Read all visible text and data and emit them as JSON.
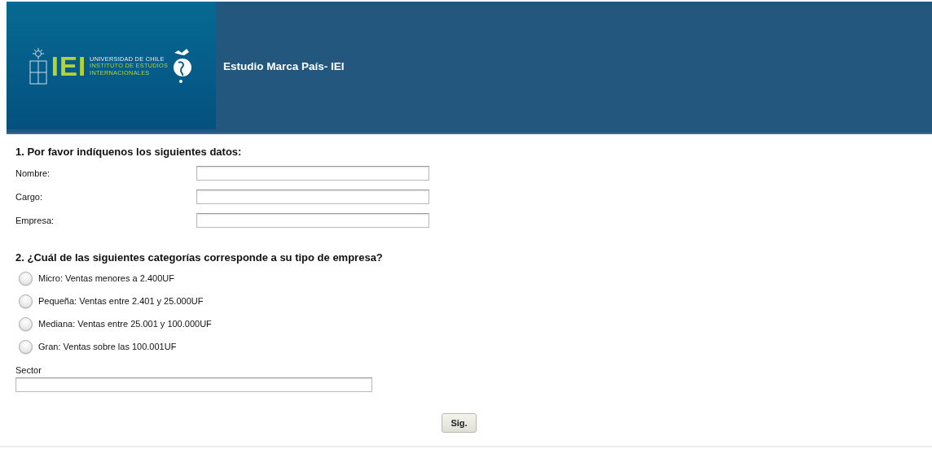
{
  "header": {
    "logo": {
      "acronym": "IEI",
      "lines": [
        "UNIVERSIDAD DE CHILE",
        "INSTITUTO DE ESTUDIOS",
        "INTERNACIONALES"
      ]
    },
    "title": "Estudio Marca País- IEI"
  },
  "question_1": {
    "title": "1. Por favor indíquenos los siguientes datos:",
    "fields": [
      {
        "label": "Nombre:"
      },
      {
        "label": "Cargo:"
      },
      {
        "label": "Empresa:"
      }
    ]
  },
  "question_2": {
    "title": "2. ¿Cuál de las siguientes categorías corresponde a su tipo de empresa?",
    "options": [
      {
        "label": "Micro: Ventas menores a 2.400UF",
        "selected": false
      },
      {
        "label": "Pequeña: Ventas entre 2.401 y 25.000UF",
        "selected": false
      },
      {
        "label": "Mediana: Ventas entre 25.001 y 100.000UF",
        "selected": false
      },
      {
        "label": "Gran: Ventas sobre las 100.001UF",
        "selected": false
      }
    ]
  },
  "sector": {
    "label": "Sector"
  },
  "next_button": "Sig."
}
